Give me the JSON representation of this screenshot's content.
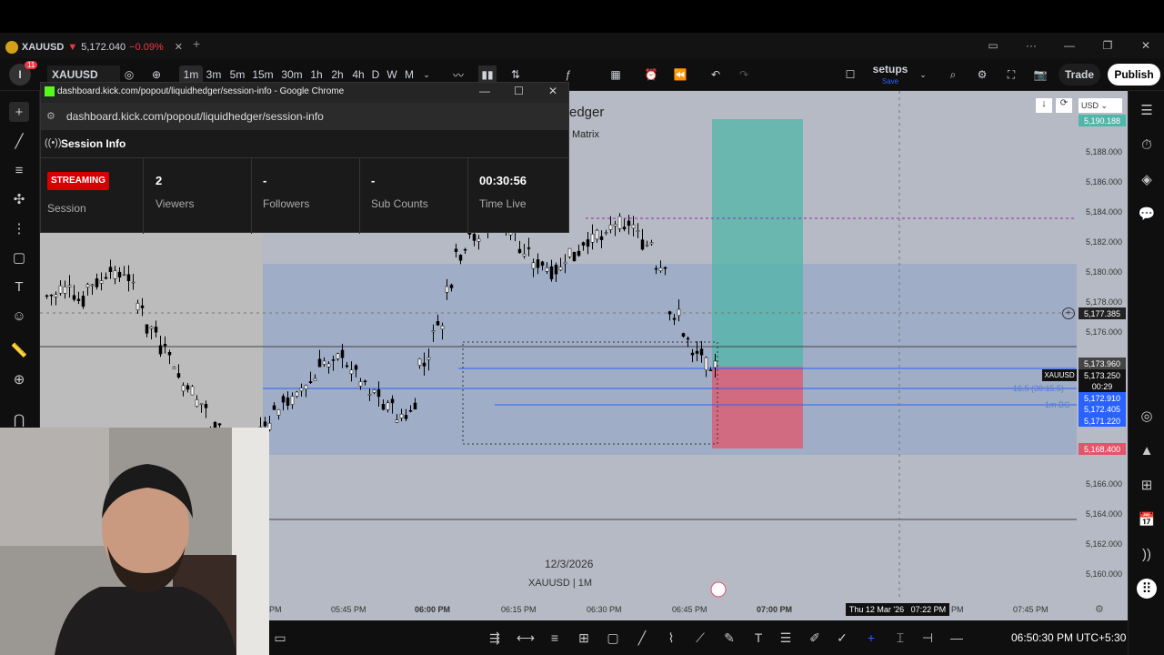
{
  "tab": {
    "symbol": "XAUUSD",
    "arrow": "▼",
    "price": "5,172.040",
    "change": "−0.09%"
  },
  "toolbar": {
    "notifications": "11",
    "symbol": "XAUUSD",
    "intervals": [
      "1m",
      "3m",
      "5m",
      "15m",
      "30m",
      "1h",
      "2h",
      "4h",
      "D",
      "W",
      "M"
    ],
    "active_interval": "1m",
    "layout_name": "setups",
    "layout_status": "Save",
    "trade_label": "Trade",
    "publish_label": "Publish"
  },
  "popup": {
    "window_title": "dashboard.kick.com/popout/liquidhedger/session-info - Google Chrome",
    "url": "dashboard.kick.com/popout/liquidhedger/session-info",
    "header": "Session Info",
    "badge": "STREAMING",
    "session_label": "Session",
    "stats": [
      {
        "value": "2",
        "label": "Viewers"
      },
      {
        "value": "-",
        "label": "Followers"
      },
      {
        "value": "-",
        "label": "Sub Counts"
      },
      {
        "value": "00:30:56",
        "label": "Time Live"
      }
    ]
  },
  "chart": {
    "title_fragment": "edger",
    "subtitle_fragment": "Matrix",
    "watermark_date": "12/3/2026",
    "watermark_symbol": "XAUUSD | 1M",
    "currency": "USD",
    "price_labels": [
      "5,188.000",
      "5,186.000",
      "5,184.000",
      "5,182.000",
      "5,180.000",
      "5,178.000",
      "5,176.000",
      "5,166.000",
      "5,164.000",
      "5,162.000",
      "5,160.000"
    ],
    "top_tag": "5,190.188",
    "crosshair_price": "5,177.385",
    "tag_upper": "5,173.960",
    "symbol_tag": "XAUUSD",
    "last_price": "5,173.250",
    "countdown": "00:29",
    "blue_tags": [
      "5,172.910",
      "5,172.405",
      "5,171.220"
    ],
    "stop_tag": "5,168.400",
    "line_label_1": "16.5 (30:15.5)",
    "line_label_2": "1m BC",
    "time_labels": [
      "PM",
      "05:45 PM",
      "06:00 PM",
      "06:15 PM",
      "06:30 PM",
      "06:45 PM",
      "07:00 PM",
      "PM",
      "07:45 PM"
    ],
    "crosshair_time": "Thu 12 Mar '26   07:22 PM",
    "clock": "06:50:30 PM UTC+5:30",
    "colors": {
      "profit": "#4fb6a8",
      "loss": "#e2556b",
      "accent": "#2962ff"
    }
  }
}
